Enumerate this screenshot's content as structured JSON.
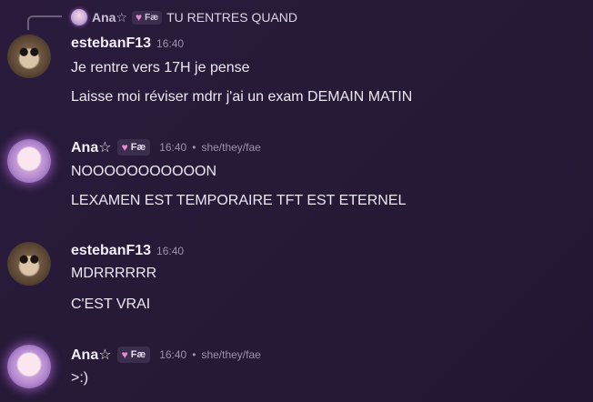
{
  "reply": {
    "name": "Ana☆",
    "tag": "Fæ",
    "text": "TU RENTRES QUAND"
  },
  "messages": [
    {
      "author": "estebanF13",
      "time": "16:40",
      "lines": [
        "Je rentre vers 17H je pense",
        "Laisse moi réviser mdrr j'ai un exam DEMAIN MATIN"
      ]
    },
    {
      "author": "Ana☆",
      "tag": "Fæ",
      "time": "16:40",
      "pronouns": "she/they/fae",
      "lines": [
        "NOOOOOOOOOOON",
        "LEXAMEN EST TEMPORAIRE TFT EST ETERNEL"
      ]
    },
    {
      "author": "estebanF13",
      "time": "16:40",
      "lines": [
        "MDRRRRRR",
        "C'EST VRAI"
      ]
    },
    {
      "author": "Ana☆",
      "tag": "Fæ",
      "time": "16:40",
      "pronouns": "she/they/fae",
      "lines": [
        ">:)"
      ]
    }
  ],
  "separator": "•",
  "icons": {
    "tag_icon": "heart-icon",
    "reply_icon": "reply-connector"
  }
}
